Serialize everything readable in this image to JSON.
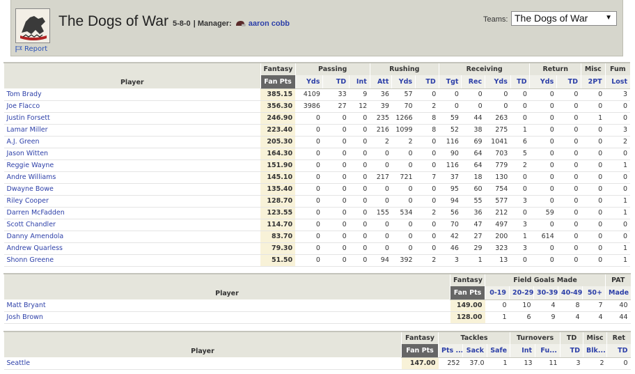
{
  "header": {
    "title": "The Dogs of War",
    "record": "5-8-0",
    "manager_label": "| Manager:",
    "manager_name": "aaron cobb",
    "report_label": "Report",
    "teams_label": "Teams:",
    "teams_selected": "The Dogs of War"
  },
  "offense": {
    "groups": [
      "Fantasy",
      "Passing",
      "Rushing",
      "Receiving",
      "Return",
      "Misc",
      "Fum"
    ],
    "player_label": "Player",
    "cols": [
      "Fan Pts",
      "Yds",
      "TD",
      "Int",
      "Att",
      "Yds",
      "TD",
      "Tgt",
      "Rec",
      "Yds",
      "TD",
      "Yds",
      "TD",
      "2PT",
      "Lost"
    ],
    "rows": [
      {
        "name": "Tom Brady",
        "pts": "385.15",
        "stats": [
          "4109",
          "33",
          "9",
          "36",
          "57",
          "0",
          "0",
          "0",
          "0",
          "0",
          "0",
          "0",
          "0",
          "3"
        ]
      },
      {
        "name": "Joe Flacco",
        "pts": "356.30",
        "stats": [
          "3986",
          "27",
          "12",
          "39",
          "70",
          "2",
          "0",
          "0",
          "0",
          "0",
          "0",
          "0",
          "0",
          "0"
        ]
      },
      {
        "name": "Justin Forsett",
        "pts": "246.90",
        "stats": [
          "0",
          "0",
          "0",
          "235",
          "1266",
          "8",
          "59",
          "44",
          "263",
          "0",
          "0",
          "0",
          "1",
          "0"
        ]
      },
      {
        "name": "Lamar Miller",
        "pts": "223.40",
        "stats": [
          "0",
          "0",
          "0",
          "216",
          "1099",
          "8",
          "52",
          "38",
          "275",
          "1",
          "0",
          "0",
          "0",
          "3"
        ]
      },
      {
        "name": "A.J. Green",
        "pts": "205.30",
        "stats": [
          "0",
          "0",
          "0",
          "2",
          "2",
          "0",
          "116",
          "69",
          "1041",
          "6",
          "0",
          "0",
          "0",
          "2"
        ]
      },
      {
        "name": "Jason Witten",
        "pts": "164.30",
        "stats": [
          "0",
          "0",
          "0",
          "0",
          "0",
          "0",
          "90",
          "64",
          "703",
          "5",
          "0",
          "0",
          "0",
          "0"
        ]
      },
      {
        "name": "Reggie Wayne",
        "pts": "151.90",
        "stats": [
          "0",
          "0",
          "0",
          "0",
          "0",
          "0",
          "116",
          "64",
          "779",
          "2",
          "0",
          "0",
          "0",
          "1"
        ]
      },
      {
        "name": "Andre Williams",
        "pts": "145.10",
        "stats": [
          "0",
          "0",
          "0",
          "217",
          "721",
          "7",
          "37",
          "18",
          "130",
          "0",
          "0",
          "0",
          "0",
          "0"
        ]
      },
      {
        "name": "Dwayne Bowe",
        "pts": "135.40",
        "stats": [
          "0",
          "0",
          "0",
          "0",
          "0",
          "0",
          "95",
          "60",
          "754",
          "0",
          "0",
          "0",
          "0",
          "0"
        ]
      },
      {
        "name": "Riley Cooper",
        "pts": "128.70",
        "stats": [
          "0",
          "0",
          "0",
          "0",
          "0",
          "0",
          "94",
          "55",
          "577",
          "3",
          "0",
          "0",
          "0",
          "1"
        ]
      },
      {
        "name": "Darren McFadden",
        "pts": "123.55",
        "stats": [
          "0",
          "0",
          "0",
          "155",
          "534",
          "2",
          "56",
          "36",
          "212",
          "0",
          "59",
          "0",
          "0",
          "1"
        ]
      },
      {
        "name": "Scott Chandler",
        "pts": "114.70",
        "stats": [
          "0",
          "0",
          "0",
          "0",
          "0",
          "0",
          "70",
          "47",
          "497",
          "3",
          "0",
          "0",
          "0",
          "0"
        ]
      },
      {
        "name": "Danny Amendola",
        "pts": "83.70",
        "stats": [
          "0",
          "0",
          "0",
          "0",
          "0",
          "0",
          "42",
          "27",
          "200",
          "1",
          "614",
          "0",
          "0",
          "0"
        ]
      },
      {
        "name": "Andrew Quarless",
        "pts": "79.30",
        "stats": [
          "0",
          "0",
          "0",
          "0",
          "0",
          "0",
          "46",
          "29",
          "323",
          "3",
          "0",
          "0",
          "0",
          "1"
        ]
      },
      {
        "name": "Shonn Greene",
        "pts": "51.50",
        "stats": [
          "0",
          "0",
          "0",
          "94",
          "392",
          "2",
          "3",
          "1",
          "13",
          "0",
          "0",
          "0",
          "0",
          "1"
        ]
      }
    ]
  },
  "kickers": {
    "groups": [
      "Fantasy",
      "Field Goals Made",
      "PAT"
    ],
    "player_label": "Player",
    "cols": [
      "Fan Pts",
      "0-19",
      "20-29",
      "30-39",
      "40-49",
      "50+",
      "Made"
    ],
    "rows": [
      {
        "name": "Matt Bryant",
        "pts": "149.00",
        "stats": [
          "0",
          "10",
          "4",
          "8",
          "7",
          "40"
        ]
      },
      {
        "name": "Josh Brown",
        "pts": "128.00",
        "stats": [
          "1",
          "6",
          "9",
          "4",
          "4",
          "44"
        ]
      }
    ]
  },
  "defense": {
    "groups": [
      "Fantasy",
      "Tackles",
      "Turnovers",
      "TD",
      "Misc",
      "Ret"
    ],
    "player_label": "Player",
    "cols": [
      "Fan Pts",
      "Pts ...",
      "Sack",
      "Safe",
      "Int",
      "Fu...",
      "TD",
      "Blk...",
      "TD"
    ],
    "rows": [
      {
        "name": "Seattle",
        "pts": "147.00",
        "stats": [
          "252",
          "37.0",
          "1",
          "13",
          "11",
          "3",
          "2",
          "0"
        ]
      }
    ]
  },
  "colors": {
    "accent_link": "#2c3fa8",
    "header_bg": "#d6d6cc",
    "fanpts_header": "#666666",
    "pts_cell": "#f8f2d8"
  }
}
